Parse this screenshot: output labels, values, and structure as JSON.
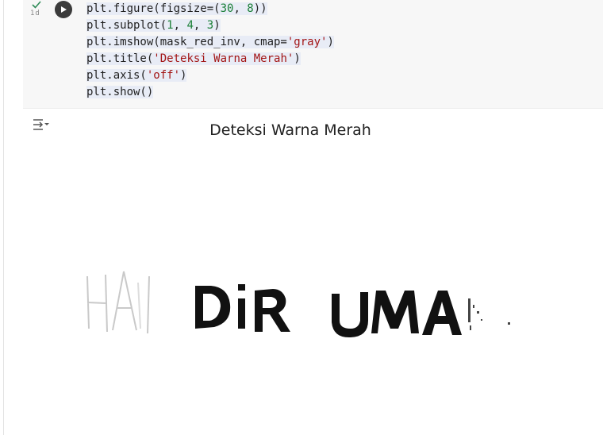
{
  "cell": {
    "execution_label": "1d",
    "code_lines": [
      [
        {
          "t": "plt.figure(figsize=("
        },
        {
          "t": "30",
          "c": "num"
        },
        {
          "t": ", "
        },
        {
          "t": "8",
          "c": "num"
        },
        {
          "t": "))"
        }
      ],
      [
        {
          "t": "plt.subplot("
        },
        {
          "t": "1",
          "c": "num"
        },
        {
          "t": ", "
        },
        {
          "t": "4",
          "c": "num"
        },
        {
          "t": ", "
        },
        {
          "t": "3",
          "c": "num"
        },
        {
          "t": ")"
        }
      ],
      [
        {
          "t": "plt.imshow(mask_red_inv, cmap="
        },
        {
          "t": "'gray'",
          "c": "str"
        },
        {
          "t": ")"
        }
      ],
      [
        {
          "t": "plt.title("
        },
        {
          "t": "'Deteksi Warna Merah'",
          "c": "str"
        },
        {
          "t": ")"
        }
      ],
      [
        {
          "t": "plt.axis("
        },
        {
          "t": "'off'",
          "c": "str"
        },
        {
          "t": ")"
        }
      ],
      [
        {
          "t": "plt.show()"
        }
      ]
    ]
  },
  "output": {
    "figure_title": "Deteksi Warna Merah",
    "image_text": "HAIDIR UMAR",
    "icons": [
      "run-cell-icon",
      "output-actions-icon",
      "execution-success-icon"
    ]
  },
  "colors": {
    "cell_background": "#f7f7f7",
    "highlight": "#e8ecf6",
    "string": "#a31515",
    "number": "#1a7f37"
  }
}
